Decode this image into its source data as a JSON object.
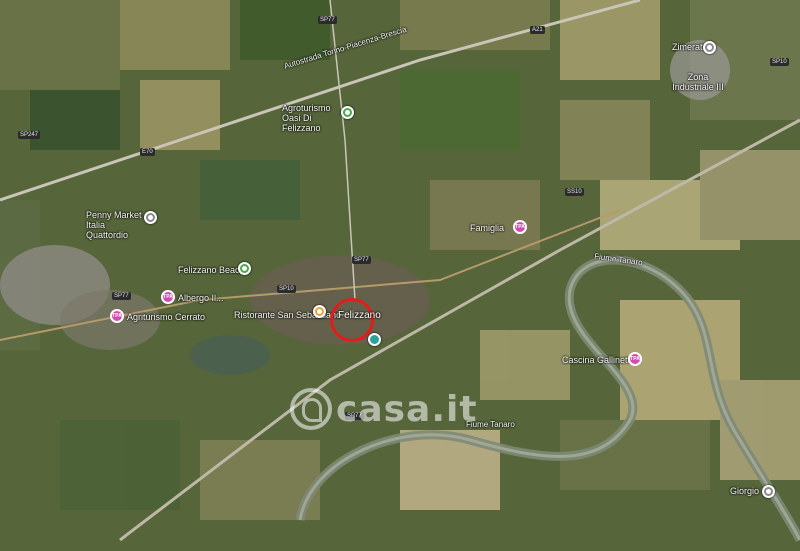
{
  "map": {
    "center_label": "Felizzano",
    "watermark_text": "casa.it",
    "places": [
      {
        "id": "zimerat",
        "text": "Zimerat"
      },
      {
        "id": "zona-industriale",
        "text": "Zona Industriale III"
      },
      {
        "id": "autostrada",
        "text": "Autostrada Torino-Piacenza-Brescia"
      },
      {
        "id": "agro-oasi",
        "text": "Agroturismo Oasi Di Felizzano"
      },
      {
        "id": "penny",
        "text": "Penny Market Italia Quattordio"
      },
      {
        "id": "felizzano-beach",
        "text": "Felizzano Beach"
      },
      {
        "id": "albergo",
        "text": "Albergo Il..."
      },
      {
        "id": "agriturismo",
        "text": "Agriturismo Cerrato"
      },
      {
        "id": "ristorante",
        "text": "Ristorante San Sebastiano"
      },
      {
        "id": "fiume-tanaro-n",
        "text": "Fiume Tanaro"
      },
      {
        "id": "cascina",
        "text": "Cascina Gallinetta"
      },
      {
        "id": "fiume-tanaro-s",
        "text": "Fiume Tanaro"
      },
      {
        "id": "giorgio",
        "text": "Giorgio"
      },
      {
        "id": "famiglia",
        "text": "Famiglia"
      }
    ],
    "roads": [
      "SP77",
      "SP247",
      "SP10",
      "SP77",
      "SP10",
      "SP77",
      "E70",
      "A21",
      "SP77",
      "SS10"
    ],
    "pin_colors": {
      "grey": "#8a8a8a",
      "green": "#4aa84a",
      "orange": "#e8a43a",
      "teal": "#2aa39a",
      "pink": "#d24bb1"
    }
  }
}
